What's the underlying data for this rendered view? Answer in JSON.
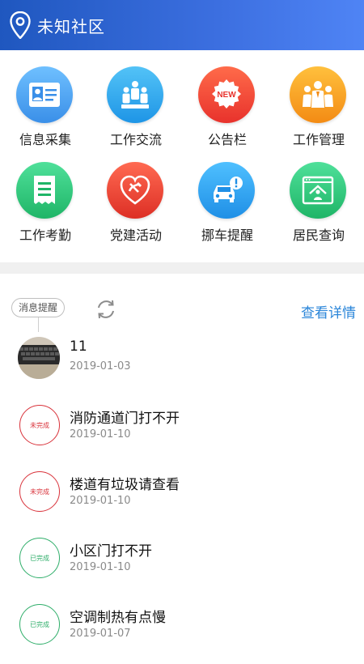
{
  "header": {
    "title": "未知社区",
    "icon": "location-pin-icon"
  },
  "grid": [
    {
      "label": "信息采集",
      "icon": "id-card-icon",
      "color": "#4aa3f0"
    },
    {
      "label": "工作交流",
      "icon": "people-group-icon",
      "color": "#2fa7ec"
    },
    {
      "label": "公告栏",
      "icon": "new-badge-icon",
      "color": "#f0463c"
    },
    {
      "label": "工作管理",
      "icon": "team-management-icon",
      "color": "#f6a623"
    },
    {
      "label": "工作考勤",
      "icon": "receipt-icon",
      "color": "#2ec27e"
    },
    {
      "label": "党建活动",
      "icon": "party-emblem-icon",
      "color": "#e8402e"
    },
    {
      "label": "挪车提醒",
      "icon": "car-alert-icon",
      "color": "#2f9ae8"
    },
    {
      "label": "居民查询",
      "icon": "resident-home-icon",
      "color": "#2ebd7a"
    }
  ],
  "notice": {
    "tag": "消息提醒",
    "detail_link": "查看详情"
  },
  "messages": [
    {
      "title": "11",
      "date": "2019-01-03",
      "badge": ""
    },
    {
      "title": "消防通道门打不开",
      "date": "2019-01-10",
      "badge": "未完成",
      "status_color": "#d9333b"
    },
    {
      "title": "楼道有垃圾请查看",
      "date": "2019-01-10",
      "badge": "未完成",
      "status_color": "#d9333b"
    },
    {
      "title": "小区门打不开",
      "date": "2019-01-10",
      "badge": "已完成",
      "status_color": "#2fae6a"
    },
    {
      "title": "空调制热有点慢",
      "date": "2019-01-07",
      "badge": "已完成",
      "status_color": "#2fae6a"
    }
  ]
}
